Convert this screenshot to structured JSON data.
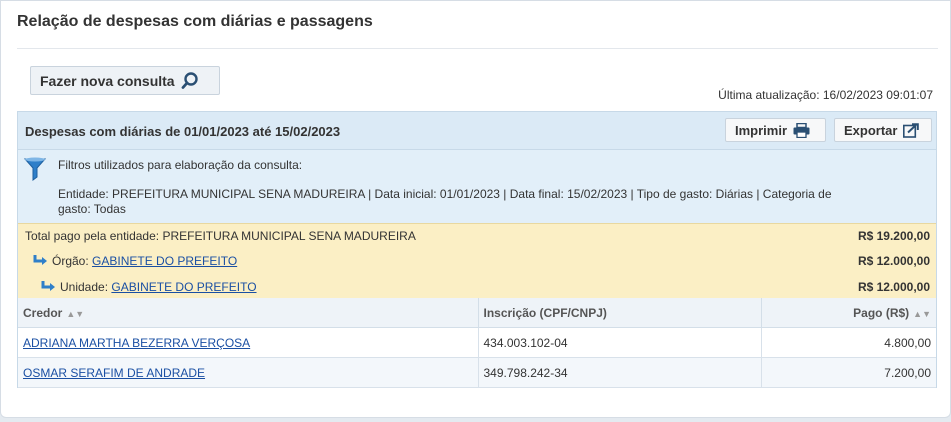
{
  "page": {
    "title": "Relação de despesas com diárias e passagens",
    "new_query_label": "Fazer nova consulta",
    "last_update": "Última atualização: 16/02/2023 09:01:07"
  },
  "report": {
    "title": "Despesas com diárias de 01/01/2023 até 15/02/2023",
    "print_label": "Imprimir",
    "export_label": "Exportar"
  },
  "filters": {
    "label": "Filtros utilizados para elaboração da consulta:",
    "text": "Entidade: PREFEITURA MUNICIPAL SENA MADUREIRA | Data inicial: 01/01/2023 | Data final: 15/02/2023 | Tipo de gasto: Diárias | Categoria de gasto: Todas"
  },
  "totals": {
    "entity_label": "Total pago pela entidade: PREFEITURA MUNICIPAL SENA MADUREIRA",
    "entity_amount": "R$ 19.200,00",
    "orgao_label": "Órgão:",
    "orgao_link": "GABINETE DO PREFEITO",
    "orgao_amount": "R$ 12.000,00",
    "unidade_label": "Unidade:",
    "unidade_link": "GABINETE DO PREFEITO",
    "unidade_amount": "R$ 12.000,00"
  },
  "table": {
    "headers": [
      "Credor",
      "Inscrição (CPF/CNPJ)",
      "Pago (R$)"
    ],
    "rows": [
      {
        "credor": "ADRIANA MARTHA BEZERRA VERÇOSA",
        "inscricao": "434.003.102-04",
        "pago": "4.800,00"
      },
      {
        "credor": "OSMAR SERAFIM DE ANDRADE",
        "inscricao": "349.798.242-34",
        "pago": "7.200,00"
      }
    ]
  },
  "colors": {
    "link": "#1a4fa3",
    "header_bg": "#dbeaf6",
    "filter_bg": "#e2eff9",
    "totals_bg": "#fbefc5",
    "icon_blue": "#2f7fc9"
  },
  "icons": [
    "search-icon",
    "printer-icon",
    "export-icon",
    "funnel-icon",
    "subdirectory-arrow-icon",
    "sort-icon"
  ]
}
